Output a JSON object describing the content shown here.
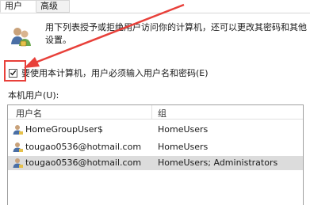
{
  "tabs": [
    {
      "label": "用户",
      "selected": true
    },
    {
      "label": "高级",
      "selected": false
    }
  ],
  "description": "用下列表授予或拒绝用户访问你的计算机，还可以更改其密码和其他设置。",
  "require_password": {
    "label": "要使用本计算机，用户必须输入用户名和密码(E)",
    "checked": true
  },
  "users_section": {
    "label": "本机用户(U):",
    "columns": [
      "用户名",
      "组"
    ],
    "rows": [
      {
        "name": "HomeGroupUser$",
        "group": "HomeUsers",
        "selected": false
      },
      {
        "name": "tougao0536@hotmail.com",
        "group": "HomeUsers",
        "selected": false
      },
      {
        "name": "tougao0536@hotmail.com",
        "group": "HomeUsers; Administrators",
        "selected": true
      }
    ]
  },
  "colors": {
    "annotation_red": "#e8403a",
    "selected_row": "#dcdcdc"
  },
  "icons": [
    "users-group-icon",
    "user-icon",
    "checkmark-icon",
    "annotation-arrow"
  ]
}
